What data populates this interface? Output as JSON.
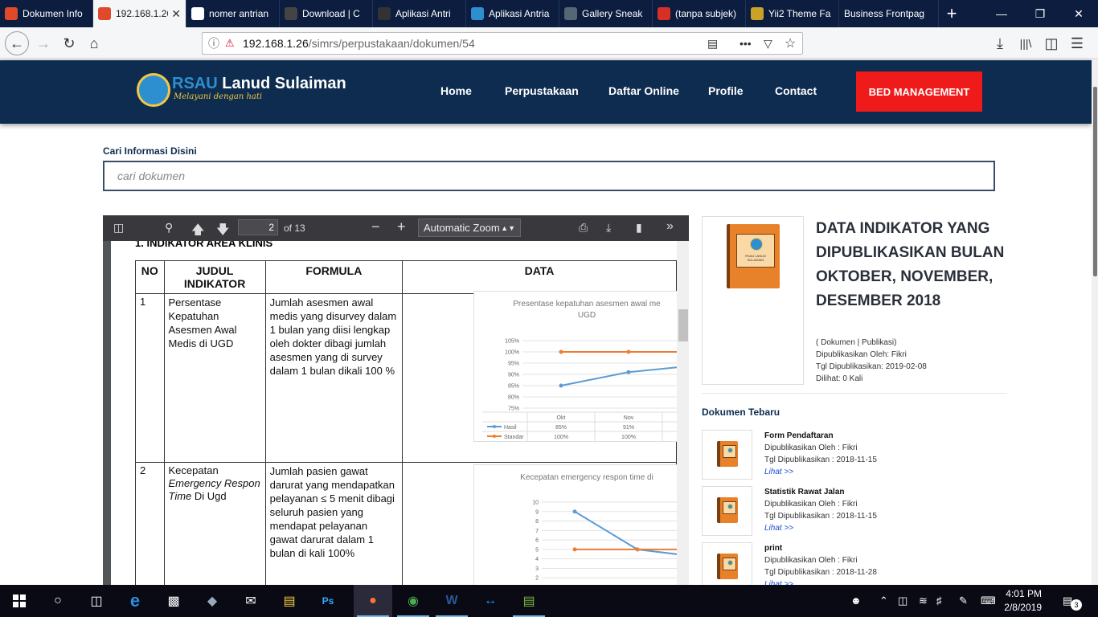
{
  "browser": {
    "tabs": [
      {
        "title": "Dokumen Info",
        "icon": "yii-icon",
        "color": "#e04a2b",
        "active": false
      },
      {
        "title": "192.168.1.26",
        "icon": "yii-icon",
        "color": "#e04a2b",
        "active": true
      },
      {
        "title": "nomer antrian",
        "icon": "google-icon",
        "color": "#ffffff",
        "active": false
      },
      {
        "title": "Download | C",
        "icon": "zh-icon",
        "color": "#444444",
        "active": false
      },
      {
        "title": "Aplikasi Antri",
        "icon": "xr-icon",
        "color": "#333333",
        "active": false
      },
      {
        "title": "Aplikasi Antria",
        "icon": "wordpress-icon",
        "color": "#2e8fd0",
        "active": false
      },
      {
        "title": "Gallery Sneak",
        "icon": "globe-icon",
        "color": "#556677",
        "active": false
      },
      {
        "title": "(tanpa subjek)",
        "icon": "gmail-icon",
        "color": "#d93025",
        "active": false
      },
      {
        "title": "Yii2 Theme Fa",
        "icon": "theme-icon",
        "color": "#c9a227",
        "active": false
      },
      {
        "title": "Business Frontpag",
        "icon": "",
        "color": "#0c1d3f",
        "active": false
      }
    ],
    "url_host": "192.168.1.26",
    "url_path": "/simrs/perpustakaan/dokumen/54"
  },
  "site": {
    "brand_prefix": "RSAU",
    "brand_name": " Lanud Sulaiman",
    "tagline": "Melayani dengan hati",
    "menu": [
      "Home",
      "Perpustakaan",
      "Daftar Online",
      "Profile",
      "Contact"
    ],
    "bed_button": "BED MANAGEMENT"
  },
  "search": {
    "label": "Cari Informasi Disini",
    "placeholder": "cari dokumen"
  },
  "pdf": {
    "page_current": "2",
    "page_total": "of 13",
    "zoom": "Automatic Zoom",
    "section_heading": "1.   INDIKATOR AREA KLINIS",
    "columns": [
      "NO",
      "JUDUL INDIKATOR",
      "FORMULA",
      "DATA"
    ],
    "rows": [
      {
        "no": "1",
        "judul": "Persentase Kepatuhan Asesmen Awal Medis di UGD",
        "formula": "Jumlah asesmen awal medis yang disurvey dalam 1 bulan yang diisi  lengkap  oleh dokter dibagi jumlah asesmen yang di survey dalam 1 bulan dikali 100 %"
      },
      {
        "no": "2",
        "judul_a": "Kecepatan",
        "judul_b": "Emergency Respon Time",
        "judul_c": " Di  Ugd",
        "formula": "Jumlah pasien gawat darurat yang mendapatkan pelayanan ≤ 5 menit dibagi seluruh pasien yang mendapat pelayanan gawat darurat dalam 1 bulan di kali 100%"
      }
    ]
  },
  "chart_data": [
    {
      "type": "line",
      "title": "Presentase kepatuhan asesmen awal me",
      "title_2": "UGD",
      "categories": [
        "Okt",
        "Nov"
      ],
      "yticks": [
        "105%",
        "100%",
        "95%",
        "90%",
        "85%",
        "80%",
        "75%"
      ],
      "ylim": [
        75,
        105
      ],
      "series": [
        {
          "name": "Hasil",
          "values": [
            85,
            91
          ],
          "labels": [
            "85%",
            "91%"
          ],
          "color": "#5b9bd5"
        },
        {
          "name": "Standar",
          "values": [
            100,
            100
          ],
          "labels": [
            "100%",
            "100%"
          ],
          "color": "#ed7d31"
        }
      ]
    },
    {
      "type": "line",
      "title": "Kecepatan emergency respon time di",
      "yticks": [
        "10",
        "9",
        "8",
        "7",
        "6",
        "5",
        "4",
        "3",
        "2",
        "1"
      ],
      "ylim": [
        0,
        10
      ],
      "series": [
        {
          "values": [
            9,
            5
          ],
          "color": "#5b9bd5"
        },
        {
          "values": [
            5,
            5
          ],
          "color": "#ed7d31"
        }
      ]
    }
  ],
  "document": {
    "title": "DATA INDIKATOR YANG DIPUBLIKASIKAN BULAN OKTOBER, NOVEMBER, DESEMBER 2018",
    "category": "( Dokumen | Publikasi)",
    "published_by": "Dipublikasikan Oleh: Fikri",
    "published_date": "Tgl Dipublikasikan: 2019-02-08",
    "views": "Dilihat: 0 Kali"
  },
  "recent": {
    "heading": "Dokumen Tebaru",
    "items": [
      {
        "title": "Form Pendaftaran",
        "by": "Dipublikasikan Oleh : Fikri",
        "date": "Tgl Dipublikasikan : 2018-11-15",
        "link": "Lihat >>"
      },
      {
        "title": "Statistik Rawat Jalan",
        "by": "Dipublikasikan Oleh : Fikri",
        "date": "Tgl Dipublikasikan : 2018-11-15",
        "link": "Lihat >>"
      },
      {
        "title": "print",
        "by": "Dipublikasikan Oleh : Fikri",
        "date": "Tgl Dipublikasikan : 2018-11-28",
        "link": "Lihat >>"
      }
    ]
  },
  "book_label": "RSAU LANUD SULAIMAN",
  "taskbar": {
    "time": "4:01 PM",
    "date": "2/8/2019",
    "notifications": "3"
  }
}
